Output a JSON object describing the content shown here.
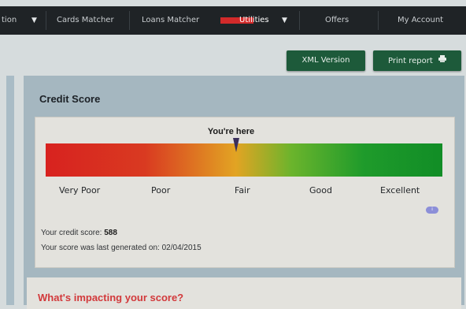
{
  "nav": {
    "items": [
      {
        "label": "tion",
        "arrow": "▼"
      },
      {
        "label": "Cards Matcher"
      },
      {
        "label": "Loans Matcher"
      },
      {
        "label": "Utilities",
        "arrow": "▼"
      },
      {
        "label": "Offers"
      },
      {
        "label": "My Account"
      }
    ],
    "accent": "#d22a2a"
  },
  "toolbar": {
    "xml_label": "XML Version",
    "print_label": "Print report",
    "print_icon": "printer-icon",
    "color": "#1d5a3a"
  },
  "credit": {
    "title": "Credit Score",
    "marker_label": "You're here",
    "marker_level": 0.48,
    "scale": [
      "Very Poor",
      "Poor",
      "Fair",
      "Good",
      "Excellent"
    ],
    "info_icon": "info-icon",
    "score_prefix": "Your credit score: ",
    "score_value": "588",
    "generated_prefix": "Your score was last generated on: ",
    "generated_date": "02/04/2015",
    "gauge_colors": [
      "#d8221f",
      "#e2a423",
      "#118d26"
    ]
  },
  "impact": {
    "title": "What's impacting your score?",
    "color": "#d2393b"
  }
}
